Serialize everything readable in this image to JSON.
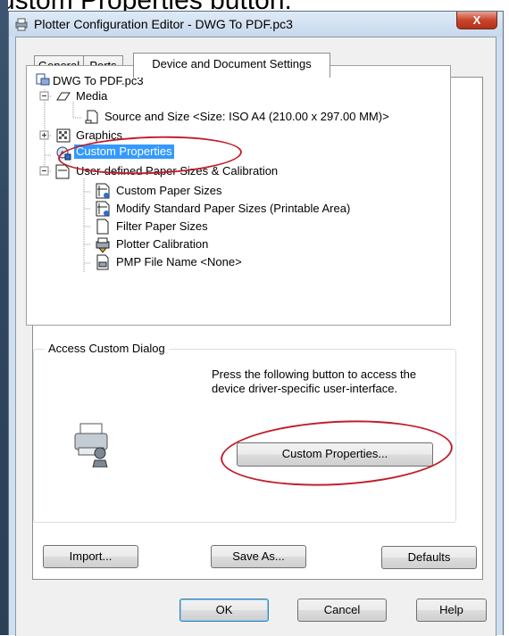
{
  "window": {
    "title": "Plotter Configuration Editor - DWG To PDF.pc3",
    "close_label": "X"
  },
  "caption_fragment": "ustom Properties button.",
  "tabs": [
    {
      "label": "General",
      "active": false
    },
    {
      "label": "Ports",
      "active": false
    },
    {
      "label": "Device and Document Settings",
      "active": true
    }
  ],
  "tree": {
    "root": "DWG To PDF.pc3",
    "items": [
      {
        "label": "Media",
        "icon": "media-icon"
      },
      {
        "label": "Source and Size <Size: ISO A4 (210.00 x 297.00 MM)>",
        "icon": "page-icon"
      },
      {
        "label": "Graphics",
        "icon": "graphics-icon"
      },
      {
        "label": "Custom Properties",
        "icon": "custom-properties-icon",
        "selected": true
      },
      {
        "label": "User-defined Paper Sizes & Calibration",
        "icon": "paper-icon"
      },
      {
        "label": "Custom Paper Sizes",
        "icon": "custom-paper-sizes-icon"
      },
      {
        "label": "Modify Standard Paper Sizes (Printable Area)",
        "icon": "modify-paper-icon"
      },
      {
        "label": "Filter Paper Sizes",
        "icon": "filter-paper-icon"
      },
      {
        "label": "Plotter Calibration",
        "icon": "plotter-calibration-icon"
      },
      {
        "label": "PMP File Name <None>",
        "icon": "pmp-file-icon"
      }
    ]
  },
  "access_group": {
    "label": "Access Custom Dialog",
    "description": "Press the following button to access the device driver-specific user-interface.",
    "button_label": "Custom Properties..."
  },
  "bottom_buttons": {
    "import": "Import...",
    "save_as": "Save As...",
    "defaults": "Defaults"
  },
  "footer_buttons": {
    "ok": "OK",
    "cancel": "Cancel",
    "help": "Help"
  },
  "colors": {
    "selection": "#3399ff",
    "annotation": "#c0202c",
    "title_bar": "#cfdff0"
  }
}
